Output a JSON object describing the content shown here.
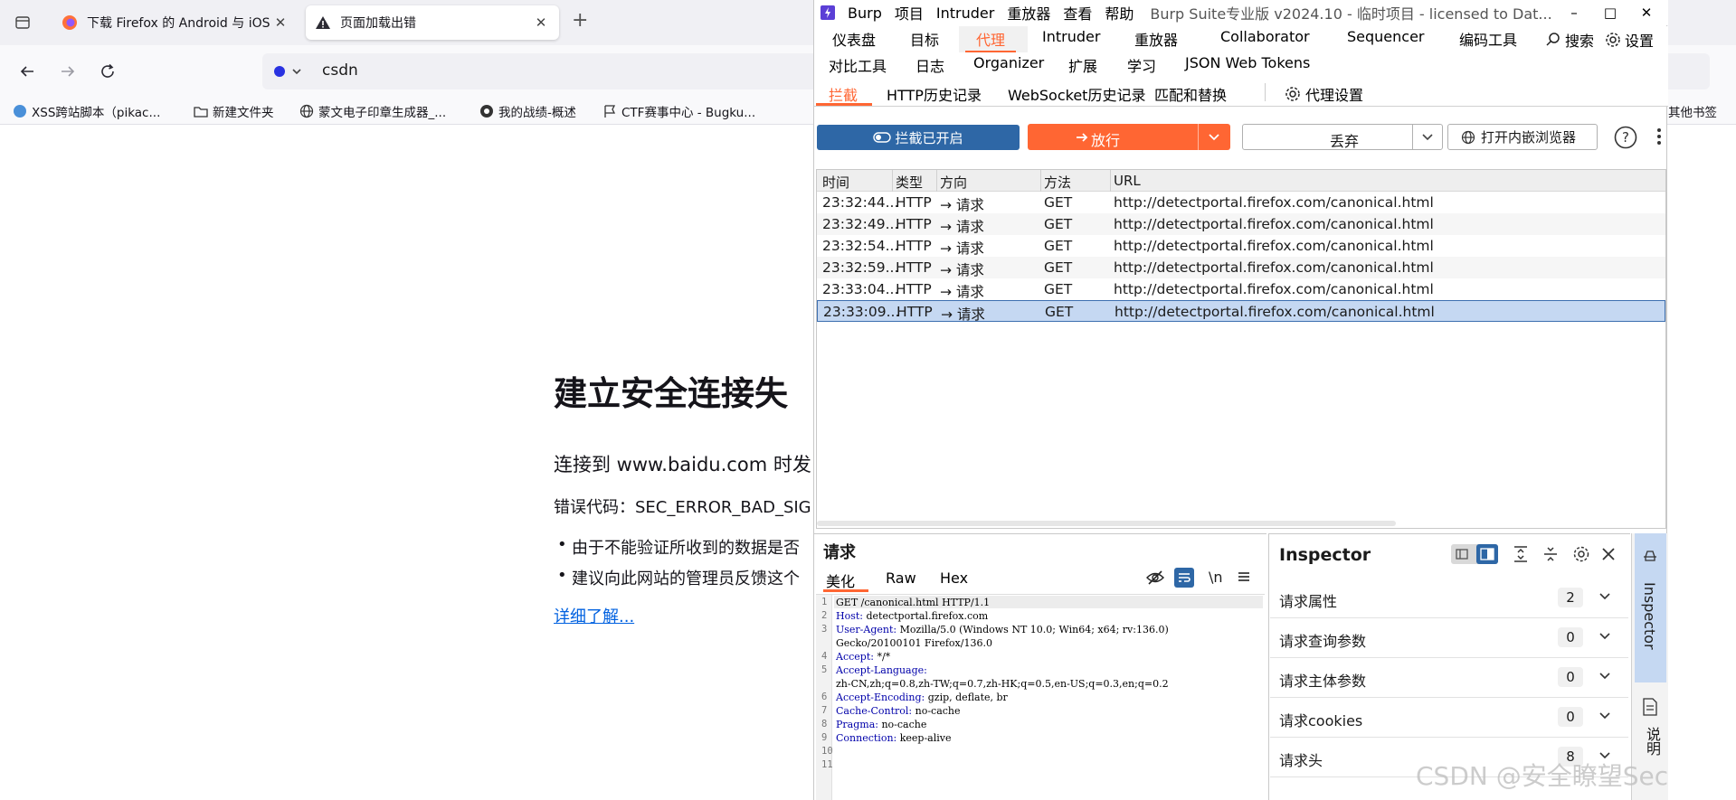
{
  "firefox": {
    "tabs": [
      {
        "title": "下载 Firefox 的 Android 与 iOS",
        "icon": "firefox-icon"
      },
      {
        "title": "页面加载出错",
        "icon": "warning-icon"
      }
    ],
    "new_tab": "+",
    "url": "csdn",
    "bookmarks": [
      "XSS跨站脚本（pikac...",
      "新建文件夹",
      "蒙文电子印章生成器_...",
      "我的战绩-概述",
      "CTF赛事中心 - Bugku...",
      "其他书签"
    ]
  },
  "error_page": {
    "title": "建立安全连接失",
    "desc": "连接到 www.baidu.com 时发",
    "code": "错误代码：SEC_ERROR_BAD_SIG",
    "bullets": [
      "由于不能验证所收到的数据是否",
      "建议向此网站的管理员反馈这个"
    ],
    "learn_more": "详细了解..."
  },
  "burp": {
    "menu": [
      "Burp",
      "项目",
      "Intruder",
      "重放器",
      "查看",
      "帮助"
    ],
    "title": "Burp Suite专业版  v2024.10 - 临时项目 - licensed to Dat...",
    "window_controls": [
      "–",
      "□",
      "✕"
    ],
    "main_tabs_row1": [
      "仪表盘",
      "目标",
      "代理",
      "Intruder",
      "重放器",
      "Collaborator",
      "Sequencer",
      "编码工具"
    ],
    "search": "搜索",
    "settings": "设置",
    "main_tabs_row2": [
      "对比工具",
      "日志",
      "Organizer",
      "扩展",
      "学习",
      "JSON Web Tokens"
    ],
    "sub_tabs": [
      "拦截",
      "HTTP历史记录",
      "WebSocket历史记录",
      "匹配和替换",
      "代理设置"
    ],
    "intercept_btn": "拦截已开启",
    "forward_btn": "放行",
    "drop_btn": "丢弃",
    "browser_btn": "打开内嵌浏览器",
    "table": {
      "headers": [
        "时间",
        "类型",
        "方向",
        "方法",
        "URL"
      ],
      "rows": [
        {
          "time": "23:32:44...",
          "type": "HTTP",
          "dir": "→  请求",
          "method": "GET",
          "url": "http://detectportal.firefox.com/canonical.html"
        },
        {
          "time": "23:32:49...",
          "type": "HTTP",
          "dir": "→  请求",
          "method": "GET",
          "url": "http://detectportal.firefox.com/canonical.html"
        },
        {
          "time": "23:32:54...",
          "type": "HTTP",
          "dir": "→  请求",
          "method": "GET",
          "url": "http://detectportal.firefox.com/canonical.html"
        },
        {
          "time": "23:32:59...",
          "type": "HTTP",
          "dir": "→  请求",
          "method": "GET",
          "url": "http://detectportal.firefox.com/canonical.html"
        },
        {
          "time": "23:33:04...",
          "type": "HTTP",
          "dir": "→  请求",
          "method": "GET",
          "url": "http://detectportal.firefox.com/canonical.html"
        },
        {
          "time": "23:33:09...",
          "type": "HTTP",
          "dir": "→  请求",
          "method": "GET",
          "url": "http://detectportal.firefox.com/canonical.html"
        }
      ]
    },
    "request": {
      "title": "请求",
      "tabs": [
        "美化",
        "Raw",
        "Hex"
      ],
      "newline_toggle": "\\n",
      "lines": [
        {
          "n": "1",
          "k": "",
          "v": "GET /canonical.html HTTP/1.1"
        },
        {
          "n": "2",
          "k": "Host:",
          "v": " detectportal.firefox.com"
        },
        {
          "n": "3",
          "k": "User-Agent:",
          "v": " Mozilla/5.0 (Windows NT 10.0; Win64; x64; rv:136.0)"
        },
        {
          "n": "",
          "k": "",
          "v": "Gecko/20100101 Firefox/136.0"
        },
        {
          "n": "4",
          "k": "Accept:",
          "v": " */*"
        },
        {
          "n": "5",
          "k": "Accept-Language:",
          "v": ""
        },
        {
          "n": "",
          "k": "",
          "v": "zh-CN,zh;q=0.8,zh-TW;q=0.7,zh-HK;q=0.5,en-US;q=0.3,en;q=0.2"
        },
        {
          "n": "6",
          "k": "Accept-Encoding:",
          "v": " gzip, deflate, br"
        },
        {
          "n": "7",
          "k": "Cache-Control:",
          "v": " no-cache"
        },
        {
          "n": "8",
          "k": "Pragma:",
          "v": " no-cache"
        },
        {
          "n": "9",
          "k": "Connection:",
          "v": " keep-alive"
        },
        {
          "n": "10",
          "k": "",
          "v": ""
        },
        {
          "n": "11",
          "k": "",
          "v": ""
        }
      ]
    },
    "inspector": {
      "title": "Inspector",
      "rows": [
        {
          "label": "请求属性",
          "count": "2"
        },
        {
          "label": "请求查询参数",
          "count": "0"
        },
        {
          "label": "请求主体参数",
          "count": "0"
        },
        {
          "label": "请求cookies",
          "count": "0"
        },
        {
          "label": "请求头",
          "count": "8"
        }
      ],
      "side_tabs": [
        "Inspector",
        "说明"
      ]
    }
  },
  "watermark": "CSDN @安全瞭望Sec",
  "colors": {
    "burp_orange": "#ff6633",
    "intercept_blue": "#2e67a6",
    "selection": "#c5d8f2"
  }
}
